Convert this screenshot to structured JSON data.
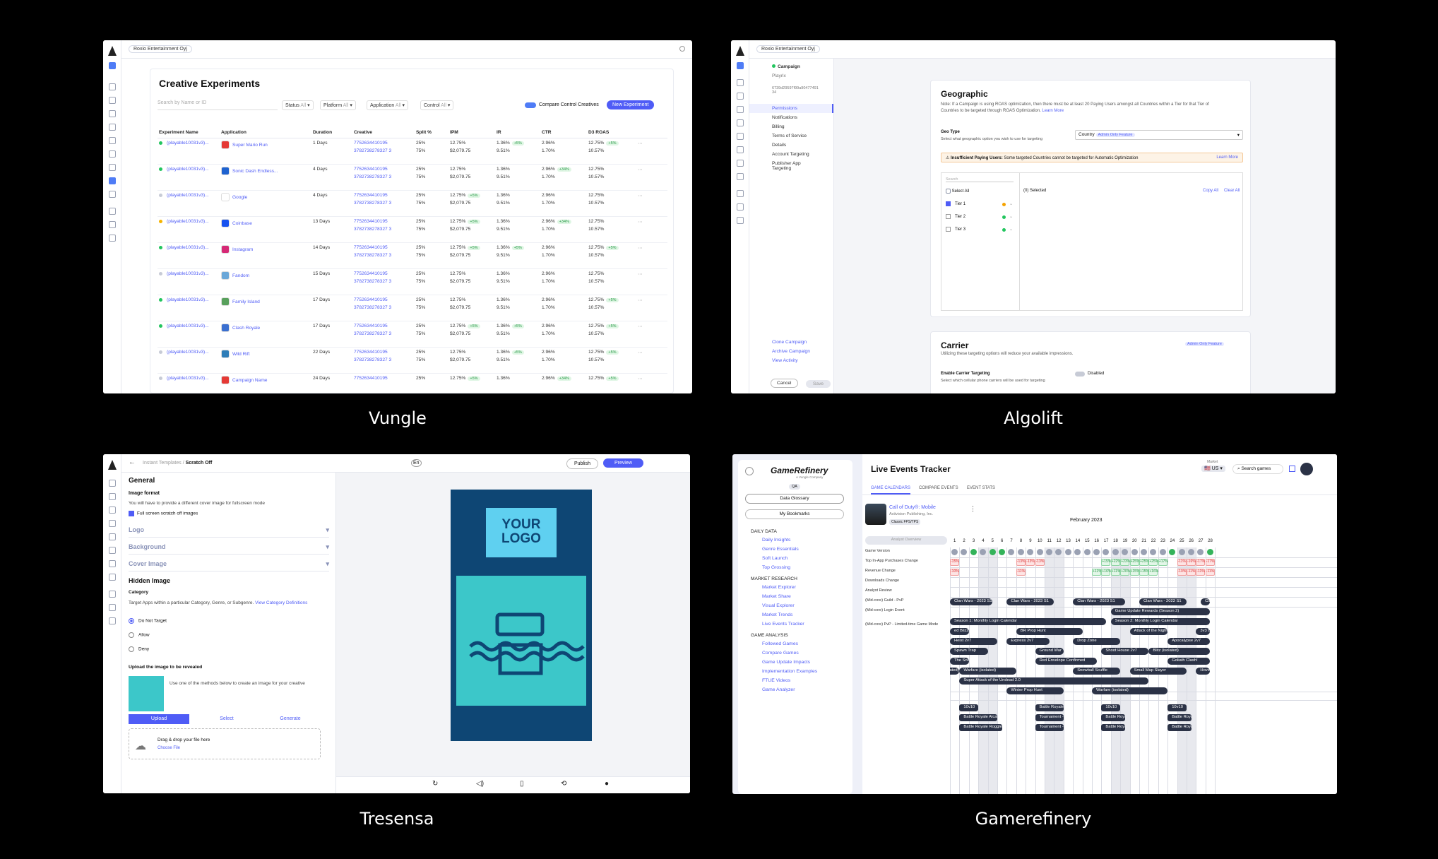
{
  "captions": {
    "vungle": "Vungle",
    "algolift": "Algolift",
    "tresensa": "Tresensa",
    "gamerefinery": "Gamerefinery"
  },
  "vungle": {
    "org": "Roxio Entertainment Oyj",
    "title": "Creative Experiments",
    "search_placeholder": "Search by Name or ID",
    "filters": [
      {
        "label": "Status",
        "value": "All"
      },
      {
        "label": "Platform",
        "value": "All"
      },
      {
        "label": "Application",
        "value": "All"
      },
      {
        "label": "Control",
        "value": "All"
      }
    ],
    "compare_label": "Compare Control Creatives",
    "new_button": "New Experiment",
    "columns": [
      "Experiment Name",
      "Application",
      "Duration",
      "Creative",
      "Split %",
      "IPM",
      "IR",
      "CTR",
      "D3 ROAS"
    ],
    "rows": [
      {
        "status": "#22c55e",
        "name": "(playable10031v3)...",
        "app": "Super Mario Run",
        "appcolor": "#e53935",
        "duration": "1 Days",
        "c1": "7752634410195",
        "c2": "3782738278327 3",
        "s1": "25%",
        "s2": "75%",
        "i1": "12.75%",
        "ip": "",
        "i2": "$2,079.75",
        "r1": "1.36%",
        "rp": "+5%",
        "r2": "9.51%",
        "t1": "2.96%",
        "tp": "",
        "t2": "1.70%",
        "d1": "12.75%",
        "dp": "+5%",
        "d2": "10.57%"
      },
      {
        "status": "#22c55e",
        "name": "(playable10031v3)...",
        "app": "Sonic Dash Endless...",
        "appcolor": "#1e62d0",
        "duration": "4 Days",
        "c1": "7752634410195",
        "c2": "3782738278327 3",
        "s1": "25%",
        "s2": "75%",
        "i1": "12.75%",
        "ip": "",
        "i2": "$2,079.75",
        "r1": "1.36%",
        "rp": "",
        "r2": "9.51%",
        "t1": "2.96%",
        "tp": "+34%",
        "t2": "1.70%",
        "d1": "12.75%",
        "dp": "",
        "d2": "10.57%"
      },
      {
        "status": "#c7cbd6",
        "name": "(playable10031v3)...",
        "app": "Google",
        "appcolor": "#ffffff",
        "duration": "4 Days",
        "c1": "7752634410195",
        "c2": "3782738278327 3",
        "s1": "25%",
        "s2": "75%",
        "i1": "12.75%",
        "ip": "+5%",
        "i2": "$2,079.75",
        "r1": "1.36%",
        "rp": "",
        "r2": "9.51%",
        "t1": "2.96%",
        "tp": "",
        "t2": "1.70%",
        "d1": "12.75%",
        "dp": "",
        "d2": "10.57%"
      },
      {
        "status": "#f5b300",
        "name": "(playable10031v3)...",
        "app": "Coinbase",
        "appcolor": "#1652f0",
        "duration": "13 Days",
        "c1": "7752634410195",
        "c2": "3782738278327 3",
        "s1": "25%",
        "s2": "75%",
        "i1": "12.75%",
        "ip": "+5%",
        "i2": "$2,079.75",
        "r1": "1.36%",
        "rp": "",
        "r2": "9.51%",
        "t1": "2.96%",
        "tp": "+34%",
        "t2": "1.70%",
        "d1": "12.75%",
        "dp": "",
        "d2": "10.57%"
      },
      {
        "status": "#22c55e",
        "name": "(playable10031v3)...",
        "app": "Instagram",
        "appcolor": "#d62976",
        "duration": "14 Days",
        "c1": "7752634410195",
        "c2": "3782738278327 3",
        "s1": "25%",
        "s2": "75%",
        "i1": "12.75%",
        "ip": "+5%",
        "i2": "$2,079.75",
        "r1": "1.36%",
        "rp": "+5%",
        "r2": "9.51%",
        "t1": "2.96%",
        "tp": "",
        "t2": "1.70%",
        "d1": "12.75%",
        "dp": "+5%",
        "d2": "10.57%"
      },
      {
        "status": "#c7cbd6",
        "name": "(playable10031v3)...",
        "app": "Fandom",
        "appcolor": "#6aa7d8",
        "duration": "15 Days",
        "c1": "7752634410195",
        "c2": "3782738278327 3",
        "s1": "25%",
        "s2": "75%",
        "i1": "12.75%",
        "ip": "",
        "i2": "$2,079.75",
        "r1": "1.36%",
        "rp": "",
        "r2": "9.51%",
        "t1": "2.96%",
        "tp": "",
        "t2": "1.70%",
        "d1": "12.75%",
        "dp": "",
        "d2": "10.57%"
      },
      {
        "status": "#22c55e",
        "name": "(playable10031v3)...",
        "app": "Family Island",
        "appcolor": "#58a05c",
        "duration": "17 Days",
        "c1": "7752634410195",
        "c2": "3782738278327 3",
        "s1": "25%",
        "s2": "75%",
        "i1": "12.75%",
        "ip": "",
        "i2": "$2,079.75",
        "r1": "1.36%",
        "rp": "",
        "r2": "9.51%",
        "t1": "2.96%",
        "tp": "",
        "t2": "1.70%",
        "d1": "12.75%",
        "dp": "+5%",
        "d2": "10.57%"
      },
      {
        "status": "#22c55e",
        "name": "(playable10031v3)...",
        "app": "Clash Royale",
        "appcolor": "#3a6fd0",
        "duration": "17 Days",
        "c1": "7752634410195",
        "c2": "3782738278327 3",
        "s1": "25%",
        "s2": "75%",
        "i1": "12.75%",
        "ip": "+5%",
        "i2": "$2,079.75",
        "r1": "1.36%",
        "rp": "+5%",
        "r2": "9.51%",
        "t1": "2.96%",
        "tp": "",
        "t2": "1.70%",
        "d1": "12.75%",
        "dp": "+5%",
        "d2": "10.57%"
      },
      {
        "status": "#c7cbd6",
        "name": "(playable10031v3)...",
        "app": "Wild Rift",
        "appcolor": "#2e7db8",
        "duration": "22 Days",
        "c1": "7752634410195",
        "c2": "3782738278327 3",
        "s1": "25%",
        "s2": "75%",
        "i1": "12.75%",
        "ip": "",
        "i2": "$2,079.75",
        "r1": "1.36%",
        "rp": "+5%",
        "r2": "9.51%",
        "t1": "2.96%",
        "tp": "",
        "t2": "1.70%",
        "d1": "12.75%",
        "dp": "+5%",
        "d2": "10.57%"
      },
      {
        "status": "#c7cbd6",
        "name": "(playable10031v3)...",
        "app": "Campaign Name",
        "appcolor": "#e53935",
        "duration": "24 Days",
        "c1": "7752634410195",
        "c2": "",
        "s1": "25%",
        "s2": "",
        "i1": "12.75%",
        "ip": "+5%",
        "i2": "",
        "r1": "1.36%",
        "rp": "",
        "r2": "",
        "t1": "2.96%",
        "tp": "+34%",
        "t2": "",
        "d1": "12.75%",
        "dp": "+5%",
        "d2": ""
      }
    ]
  },
  "algolift": {
    "org": "Roxio Entertainment Oyj",
    "campaign_label": "Campaign",
    "campaign_name": "Playrix",
    "campaign_id": "6739d29597f99a90477491 34",
    "nav": [
      "Permissions",
      "Notifications",
      "Billing",
      "Terms of Service",
      "Details",
      "Account Targeting",
      "Publisher App Targeting"
    ],
    "bottom_links": [
      "Clone Campaign",
      "Archive Campaign",
      "View Activity"
    ],
    "cancel": "Cancel",
    "save": "Save",
    "geo_title": "Geographic",
    "geo_note": "Note: If a Campaign is using ROAS optimization, then there must be at least 20 Paying Users amongst all Countries within a Tier for that Tier of Countries to be targeted through ROAS Optimization.",
    "learn_more": "Learn More",
    "geo_type": "Geo Type",
    "geo_type_help": "Select what geographic option you wish to use for targeting",
    "geo_select": "Country",
    "admin_badge": "Admin Only Feature",
    "warning_bold": "Insufficient Paying Users:",
    "warning_text": "Some targeted Countries cannot be targeted for Automatic Optimization",
    "search": "Search",
    "select_all": "Select All",
    "selected": "(0) Selected",
    "copy_all": "Copy All",
    "clear_all": "Clear All",
    "tiers": [
      "Tier 1",
      "Tier 2",
      "Tier 3"
    ],
    "carrier_title": "Carrier",
    "carrier_text": "Utilizing these targeting options will reduce your available impressions.",
    "carrier_badge": "Admin Only Feature",
    "enable_carrier": "Enable Carrier Targeting",
    "enable_help": "Select which cellular phone carriers will be used for targeting",
    "disabled": "Disabled"
  },
  "tresensa": {
    "breadcrumb_parent": "Instant Templates",
    "breadcrumb_current": "Scratch Off",
    "lang": "En",
    "publish": "Publish",
    "preview": "Preview",
    "general": "General",
    "image_format": "Image format",
    "image_format_help": "You will have to provide a different cover image for fullscreen mode",
    "fullscreen": "Full screen scratch off images",
    "sections": [
      "Logo",
      "Background",
      "Cover Image"
    ],
    "hidden": "Hidden Image",
    "category": "Category",
    "category_help": "Target Apps within a particular Category, Genre, or Subgenre.",
    "view_defs": "View Category Definitions",
    "options": [
      "Do Not Target",
      "Allow",
      "Deny"
    ],
    "upload_title": "Upload the image to be revealed",
    "upload_help": "Use one of the methods below to create an image for your creative",
    "tabs": [
      "Upload",
      "Select",
      "Generate"
    ],
    "drag": "Drag & drop your file here",
    "choose": "Choose File",
    "logo_text": "YOUR LOGO"
  },
  "gamerefinery": {
    "brand": "GameRefinery",
    "brand_sub": "A Vungle Company",
    "qa": "QA",
    "glossary": "Data Glossary",
    "bookmarks": "My Bookmarks",
    "groups": [
      {
        "title": "DAILY DATA",
        "items": [
          "Daily Insights",
          "Genre Essentials",
          "Soft Launch",
          "Top Grossing"
        ]
      },
      {
        "title": "MARKET RESEARCH",
        "items": [
          "Market Explorer",
          "Market Share",
          "Visual Explorer",
          "Market Trends",
          "Live Events Tracker"
        ]
      },
      {
        "title": "GAME ANALYSIS",
        "items": [
          "Followed Games",
          "Compare Games",
          "Game Update Impacts",
          "Implementation Examples",
          "FTUE Videos",
          "Game Analyzer"
        ]
      }
    ],
    "title": "Live Events Tracker",
    "market_label": "Market",
    "market": "US",
    "search": "Search games",
    "tabs": [
      "GAME CALENDARS",
      "COMPARE EVENTS",
      "EVENT STATS"
    ],
    "game_name": "Call of Duty®: Mobile",
    "game_pub": "Activision Publishing, Inc.",
    "game_tag": "Classic FPS/TPS",
    "analyst": "Analyst Overview",
    "month": "February 2023",
    "days": [
      "1",
      "2",
      "3",
      "4",
      "5",
      "6",
      "7",
      "8",
      "9",
      "10",
      "11",
      "12",
      "13",
      "14",
      "15",
      "16",
      "17",
      "18",
      "19",
      "20",
      "21",
      "22",
      "23",
      "24",
      "25",
      "26",
      "27",
      "28"
    ],
    "rows": [
      "Game Version",
      "Top In-App Purchases Change",
      "Revenue Change",
      "Downloads Change",
      "Analyst Review",
      "(Mid-core) Guild - PvP",
      "(Mid-core) Login Event",
      "(Mid-core) PvP - Limited-time Game Mode"
    ],
    "bars": [
      {
        "t": "Clan Wars - 2023 S1",
        "row": 0,
        "d0": 1,
        "d1": 5.5
      },
      {
        "t": "Clan Wars - 2023 S1",
        "row": 0,
        "d0": 7,
        "d1": 12
      },
      {
        "t": "Clan Wars - 2023 S1",
        "row": 0,
        "d0": 14,
        "d1": 19.5
      },
      {
        "t": "Clan Wars - 2023 S1",
        "row": 0,
        "d0": 21,
        "d1": 26
      },
      {
        "t": "Clan",
        "row": 0,
        "d0": 27.5,
        "d1": 28.5
      },
      {
        "t": "Game Update Rewards (Season 2)",
        "row": 1,
        "d0": 18,
        "d1": 28.5
      },
      {
        "t": "Season 1: Monthly Login Calendar",
        "row": 2,
        "d0": 1,
        "d1": 17.5
      },
      {
        "t": "Season 2: Monthly Login Calendar",
        "row": 2,
        "d0": 18,
        "d1": 28.5
      },
      {
        "t": "ed Blizzard",
        "row": 3,
        "d0": 1,
        "d1": 3
      },
      {
        "t": "BR Prop Hunt",
        "row": 3,
        "d0": 8,
        "d1": 15
      },
      {
        "t": "Attack of the Night",
        "row": 3,
        "d0": 20,
        "d1": 24
      },
      {
        "t": "3v3 B",
        "row": 3,
        "d0": 27,
        "d1": 28.5
      },
      {
        "t": "Heist 2v7",
        "row": 4,
        "d0": 1,
        "d1": 6
      },
      {
        "t": "Express 2v7",
        "row": 4,
        "d0": 7,
        "d1": 11.5
      },
      {
        "t": "Drop Zone",
        "row": 4,
        "d0": 14,
        "d1": 19
      },
      {
        "t": "Apocalypse 2v7",
        "row": 4,
        "d0": 24,
        "d1": 28.5
      },
      {
        "t": "Spawn Trap",
        "row": 5,
        "d0": 1,
        "d1": 5
      },
      {
        "t": "Ground War",
        "row": 5,
        "d0": 10,
        "d1": 13
      },
      {
        "t": "Shoot House 2v7",
        "row": 5,
        "d0": 17,
        "d1": 22
      },
      {
        "t": "Blitz (isolated)",
        "row": 5,
        "d0": 22,
        "d1": 28.5
      },
      {
        "t": "The Snitch",
        "row": 6,
        "d0": 1,
        "d1": 3
      },
      {
        "t": "Red Envelope Confirmed",
        "row": 6,
        "d0": 10,
        "d1": 16.5
      },
      {
        "t": "Goliath Clash!",
        "row": 6,
        "d0": 24,
        "d1": 28.5
      },
      {
        "t": "ated)",
        "row": 7,
        "d0": 0.5,
        "d1": 2
      },
      {
        "t": "Warfare (isolated)",
        "row": 7,
        "d0": 2,
        "d1": 8
      },
      {
        "t": "Snowball Scuffle",
        "row": 7,
        "d0": 14,
        "d1": 19
      },
      {
        "t": "Small Map Slayer",
        "row": 7,
        "d0": 20,
        "d1": 26
      },
      {
        "t": "Hove",
        "row": 7,
        "d0": 27,
        "d1": 28.5
      },
      {
        "t": "Super Attack of the Undead 2.0",
        "row": 8,
        "d0": 2,
        "d1": 22
      },
      {
        "t": "Winter Prop Hunt",
        "row": 9,
        "d0": 7,
        "d1": 13
      },
      {
        "t": "Warfare (isolated)",
        "row": 9,
        "d0": 16,
        "d1": 24
      }
    ],
    "chips": [
      {
        "t": "10v10",
        "row": 0,
        "d0": 2,
        "d1": 4
      },
      {
        "t": "Battle Royale ...",
        "row": 0,
        "d0": 10,
        "d1": 13
      },
      {
        "t": "10v10",
        "row": 0,
        "d0": 17,
        "d1": 19
      },
      {
        "t": "10v10",
        "row": 0,
        "d0": 24,
        "d1": 26
      },
      {
        "t": "Battle Royale Alcatraz",
        "row": 1,
        "d0": 2,
        "d1": 6
      },
      {
        "t": "Tournament - ...",
        "row": 1,
        "d0": 10,
        "d1": 13
      },
      {
        "t": "Battle Royale ...",
        "row": 1,
        "d0": 17,
        "d1": 19.5
      },
      {
        "t": "Battle Royale ...",
        "row": 1,
        "d0": 24,
        "d1": 26.5
      },
      {
        "t": "Battle Royale Rogglepotimi",
        "row": 2,
        "d0": 2,
        "d1": 6.5
      },
      {
        "t": "Tournament - ...",
        "row": 2,
        "d0": 10,
        "d1": 13
      },
      {
        "t": "Battle Royale",
        "row": 2,
        "d0": 17,
        "d1": 19.5
      },
      {
        "t": "Battle Royale ...",
        "row": 2,
        "d0": 24,
        "d1": 26.5
      }
    ],
    "iap": [
      1,
      1,
      2,
      1,
      2,
      2,
      1,
      1,
      1,
      1,
      1,
      1,
      1,
      1,
      1,
      1,
      1,
      1,
      1,
      1,
      1,
      1,
      1,
      2,
      1,
      1,
      1,
      2
    ],
    "rev": [
      "-15%",
      "",
      "",
      "",
      "",
      "",
      "",
      "-13%",
      "-13%",
      "-13%",
      "",
      "",
      "",
      "",
      "",
      "",
      "+15%",
      "+22%",
      "+23%",
      "+25%",
      "+25%",
      "+25%",
      "+17%",
      "",
      "-11%",
      "-16%",
      "-17%",
      "-17%"
    ],
    "dl": [
      "-10%",
      "",
      "",
      "",
      "",
      "",
      "",
      "-11%",
      "",
      "",
      "",
      "",
      "",
      "",
      "",
      "+11%",
      "+16%",
      "+11%",
      "+20%",
      "+15%",
      "+15%",
      "+16%",
      "",
      "",
      "-10%",
      "-11%",
      "-11%",
      "-11%"
    ]
  }
}
